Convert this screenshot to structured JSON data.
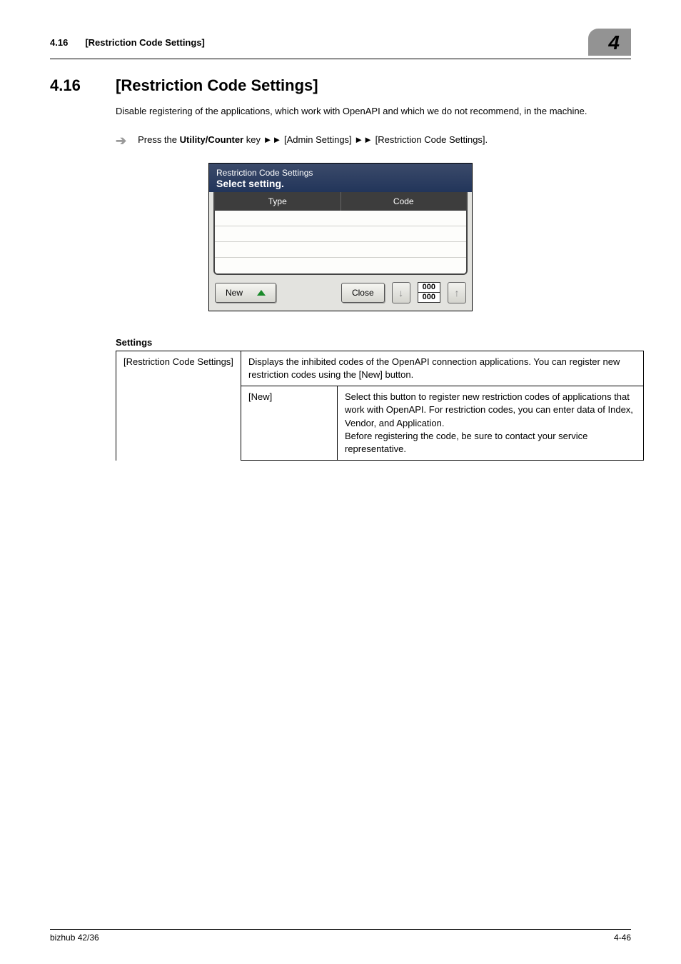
{
  "header": {
    "section_num": "4.16",
    "section_title_bracket": "[Restriction Code Settings]",
    "chapter_tab": "4"
  },
  "section": {
    "num": "4.16",
    "title": "[Restriction Code Settings]"
  },
  "intro": "Disable registering of the applications, which work with OpenAPI and which we do not recommend, in the machine.",
  "instruction": {
    "prefix": "Press the ",
    "bold": "Utility/Counter",
    "after_bold": " key ",
    "sep1": "►►",
    "path1": " [Admin Settings] ",
    "sep2": "►►",
    "path2": " [Restriction Code Settings]."
  },
  "screenshot": {
    "title_line1": "Restriction  Code Settings",
    "title_line2": "Select setting.",
    "col_type": "Type",
    "col_code": "Code",
    "btn_new": "New",
    "btn_close": "Close",
    "counter_top": "000",
    "counter_bottom": "000"
  },
  "settings_heading": "Settings",
  "table": {
    "r1c1": "[Restriction Code Settings]",
    "r1c2": "Displays the inhibited codes of the OpenAPI connection applications. You can register new restriction codes using the [New] button.",
    "r2c2": "[New]",
    "r2c3": "Select this button to register new restriction codes of applications that work with OpenAPI. For restriction codes, you can enter data of Index, Vendor, and Application.\nBefore registering the code, be sure to contact your service representative."
  },
  "footer": {
    "left": "bizhub 42/36",
    "right": "4-46"
  }
}
